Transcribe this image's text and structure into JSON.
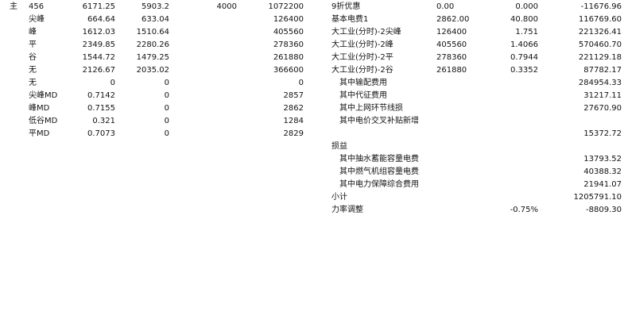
{
  "left_block": {
    "rows": [
      {
        "lead": "主",
        "label": "456",
        "v1": "6171.25",
        "v2": "5903.2",
        "v3": "4000",
        "v4": "1072200"
      },
      {
        "lead": "",
        "label": "尖峰",
        "v1": "664.64",
        "v2": "633.04",
        "v3": "",
        "v4": "126400"
      },
      {
        "lead": "",
        "label": "峰",
        "v1": "1612.03",
        "v2": "1510.64",
        "v3": "",
        "v4": "405560"
      },
      {
        "lead": "",
        "label": "平",
        "v1": "2349.85",
        "v2": "2280.26",
        "v3": "",
        "v4": "278360"
      },
      {
        "lead": "",
        "label": "谷",
        "v1": "1544.72",
        "v2": "1479.25",
        "v3": "",
        "v4": "261880"
      },
      {
        "lead": "",
        "label": "无",
        "v1": "2126.67",
        "v2": "2035.02",
        "v3": "",
        "v4": "366600"
      },
      {
        "lead": "",
        "label": "无",
        "v1": "0",
        "v2": "0",
        "v3": "",
        "v4": "0"
      },
      {
        "lead": "",
        "label": "尖峰MD",
        "v1": "0.7142",
        "v2": "0",
        "v3": "",
        "v4": "2857"
      },
      {
        "lead": "",
        "label": "峰MD",
        "v1": "0.7155",
        "v2": "0",
        "v3": "",
        "v4": "2862"
      },
      {
        "lead": "",
        "label": "低谷MD",
        "v1": "0.321",
        "v2": "0",
        "v3": "",
        "v4": "1284"
      },
      {
        "lead": "",
        "label": "平MD",
        "v1": "0.7073",
        "v2": "0",
        "v3": "",
        "v4": "2829"
      }
    ]
  },
  "right_block": {
    "rows": [
      {
        "label": "9折优惠",
        "a": "0.00",
        "b": "0.000",
        "amount": "-11676.96"
      },
      {
        "label": "基本电费1",
        "a": "2862.00",
        "b": "40.800",
        "amount": "116769.60"
      },
      {
        "label": "大工业(分时)-2尖峰",
        "a": "126400",
        "b": "1.751",
        "amount": "221326.41"
      },
      {
        "label": "大工业(分时)-2峰",
        "a": "405560",
        "b": "1.4066",
        "amount": "570460.70"
      },
      {
        "label": "大工业(分时)-2平",
        "a": "278360",
        "b": "0.7944",
        "amount": "221129.18"
      },
      {
        "label": "大工业(分时)-2谷",
        "a": "261880",
        "b": "0.3352",
        "amount": "87782.17"
      },
      {
        "label": "其中输配费用",
        "a": "",
        "b": "",
        "amount": "284954.33"
      },
      {
        "label": "其中代征费用",
        "a": "",
        "b": "",
        "amount": "31217.11"
      },
      {
        "label": "其中上网环节线损",
        "a": "",
        "b": "",
        "amount": "27670.90"
      },
      {
        "label": "其中电价交叉补贴新增",
        "a": "",
        "b": "",
        "amount": ""
      },
      {
        "label": "",
        "a": "",
        "b": "",
        "amount": "15372.72"
      },
      {
        "label": "损益",
        "a": "",
        "b": "",
        "amount": ""
      },
      {
        "label": "其中抽水蓄能容量电费",
        "a": "",
        "b": "",
        "amount": "13793.52"
      },
      {
        "label": "其中燃气机组容量电费",
        "a": "",
        "b": "",
        "amount": "40388.32"
      },
      {
        "label": "其中电力保障综合费用",
        "a": "",
        "b": "",
        "amount": "21941.07"
      },
      {
        "label": "小计",
        "a": "",
        "b": "",
        "amount": "1205791.10"
      },
      {
        "label": "力率调整",
        "a": "",
        "b": "-0.75%",
        "amount": "-8809.30"
      }
    ]
  }
}
